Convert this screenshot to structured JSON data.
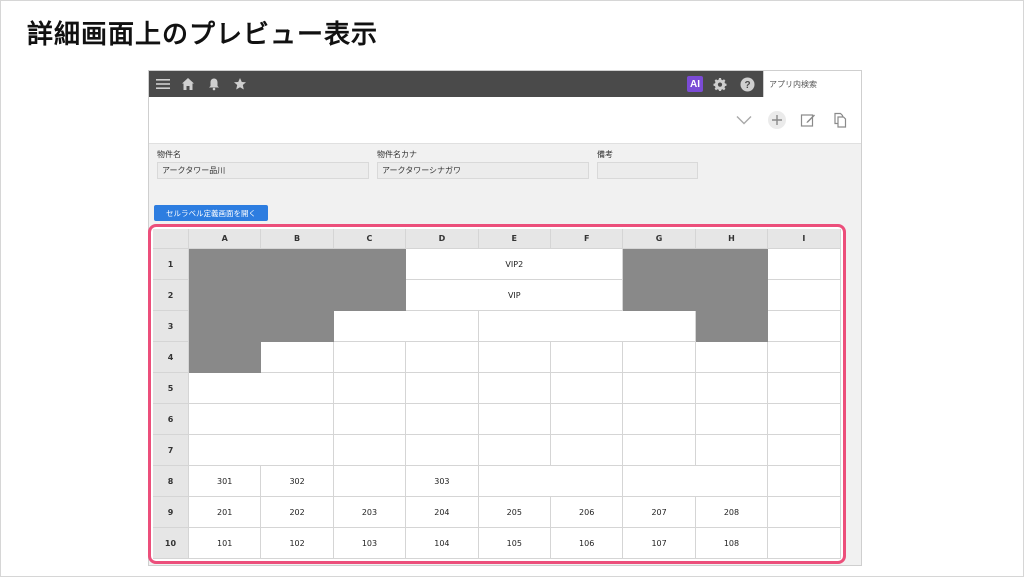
{
  "slide": {
    "title": "詳細画面上のプレビュー表示"
  },
  "topbar": {
    "icons": [
      "menu-icon",
      "home-icon",
      "bell-icon",
      "star-icon"
    ],
    "ai_badge": "AI",
    "search_placeholder": "アプリ内検索",
    "right_icons": [
      "gear-icon",
      "help-icon"
    ],
    "bar_color": "#4a4a4a",
    "ai_color": "#7b4bd6"
  },
  "toolbar": {
    "icons": [
      "chevron-down-icon",
      "add-icon",
      "edit-icon",
      "copy-icon"
    ]
  },
  "fields": [
    {
      "label": "物件名",
      "value": "アークタワー品川"
    },
    {
      "label": "物件名カナ",
      "value": "アークタワーシナガワ"
    },
    {
      "label": "備考",
      "value": ""
    }
  ],
  "open_button": {
    "label": "セルラベル定義画面を開く",
    "color": "#2d7de0"
  },
  "grid": {
    "highlight_color": "#ec4f7b",
    "columns": [
      "A",
      "B",
      "C",
      "D",
      "E",
      "F",
      "G",
      "H",
      "I"
    ],
    "rows": [
      "1",
      "2",
      "3",
      "4",
      "5",
      "6",
      "7",
      "8",
      "9",
      "10"
    ],
    "merged_labels": {
      "r1_DF": "VIP2",
      "r2_DF": "VIP"
    },
    "row8": [
      "301",
      "302",
      "",
      "303",
      "",
      "",
      "",
      "",
      ""
    ],
    "row9": [
      "201",
      "202",
      "203",
      "204",
      "205",
      "206",
      "207",
      "208",
      ""
    ],
    "row10": [
      "101",
      "102",
      "103",
      "104",
      "105",
      "106",
      "107",
      "108",
      ""
    ]
  }
}
